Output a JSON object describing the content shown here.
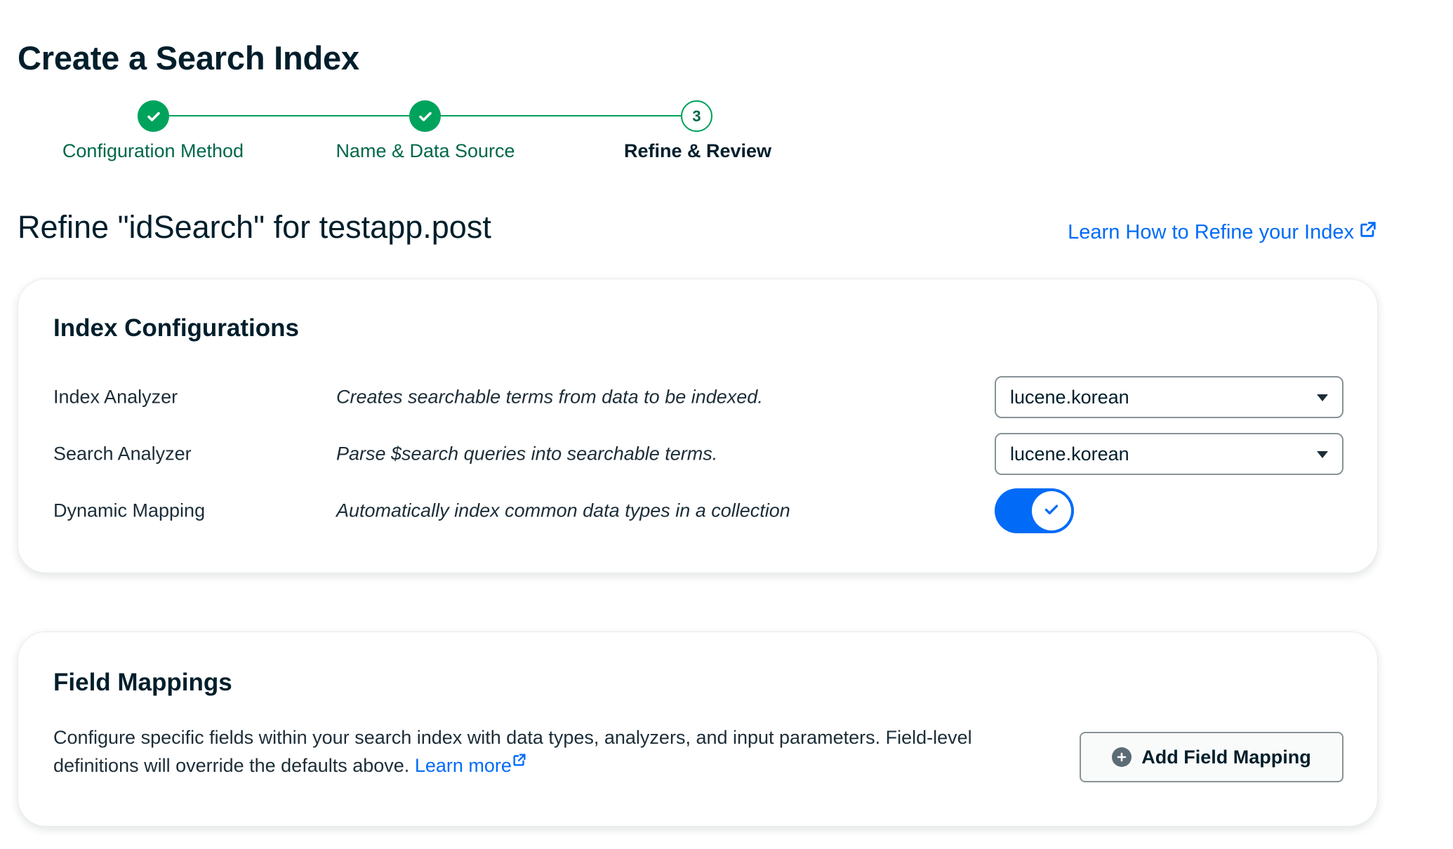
{
  "header": {
    "title": "Create a Search Index"
  },
  "stepper": {
    "steps": [
      {
        "label": "Configuration Method",
        "state": "done"
      },
      {
        "label": "Name & Data Source",
        "state": "done"
      },
      {
        "label": "Refine & Review",
        "state": "current",
        "number": "3"
      }
    ]
  },
  "refine": {
    "title": "Refine \"idSearch\" for testapp.post",
    "learn_link": "Learn How to Refine your Index"
  },
  "index_config": {
    "title": "Index Configurations",
    "rows": [
      {
        "label": "Index Analyzer",
        "description": "Creates searchable terms from data to be indexed.",
        "value": "lucene.korean"
      },
      {
        "label": "Search Analyzer",
        "description": "Parse $search queries into searchable terms.",
        "value": "lucene.korean"
      },
      {
        "label": "Dynamic Mapping",
        "description": "Automatically index common data types in a collection",
        "enabled": true
      }
    ]
  },
  "field_mappings": {
    "title": "Field Mappings",
    "description": "Configure specific fields within your search index with data types, analyzers, and input parameters. Field-level definitions will override the defaults above.",
    "learn_more": "Learn more",
    "add_button": "Add Field Mapping"
  },
  "colors": {
    "accent_green": "#00a35c",
    "link_blue": "#016bf8",
    "toggle_blue": "#016bf8"
  },
  "icons": {
    "step_done": "check-icon",
    "external": "external-link-icon",
    "add": "plus-circle-icon",
    "select": "caret-down-icon"
  }
}
